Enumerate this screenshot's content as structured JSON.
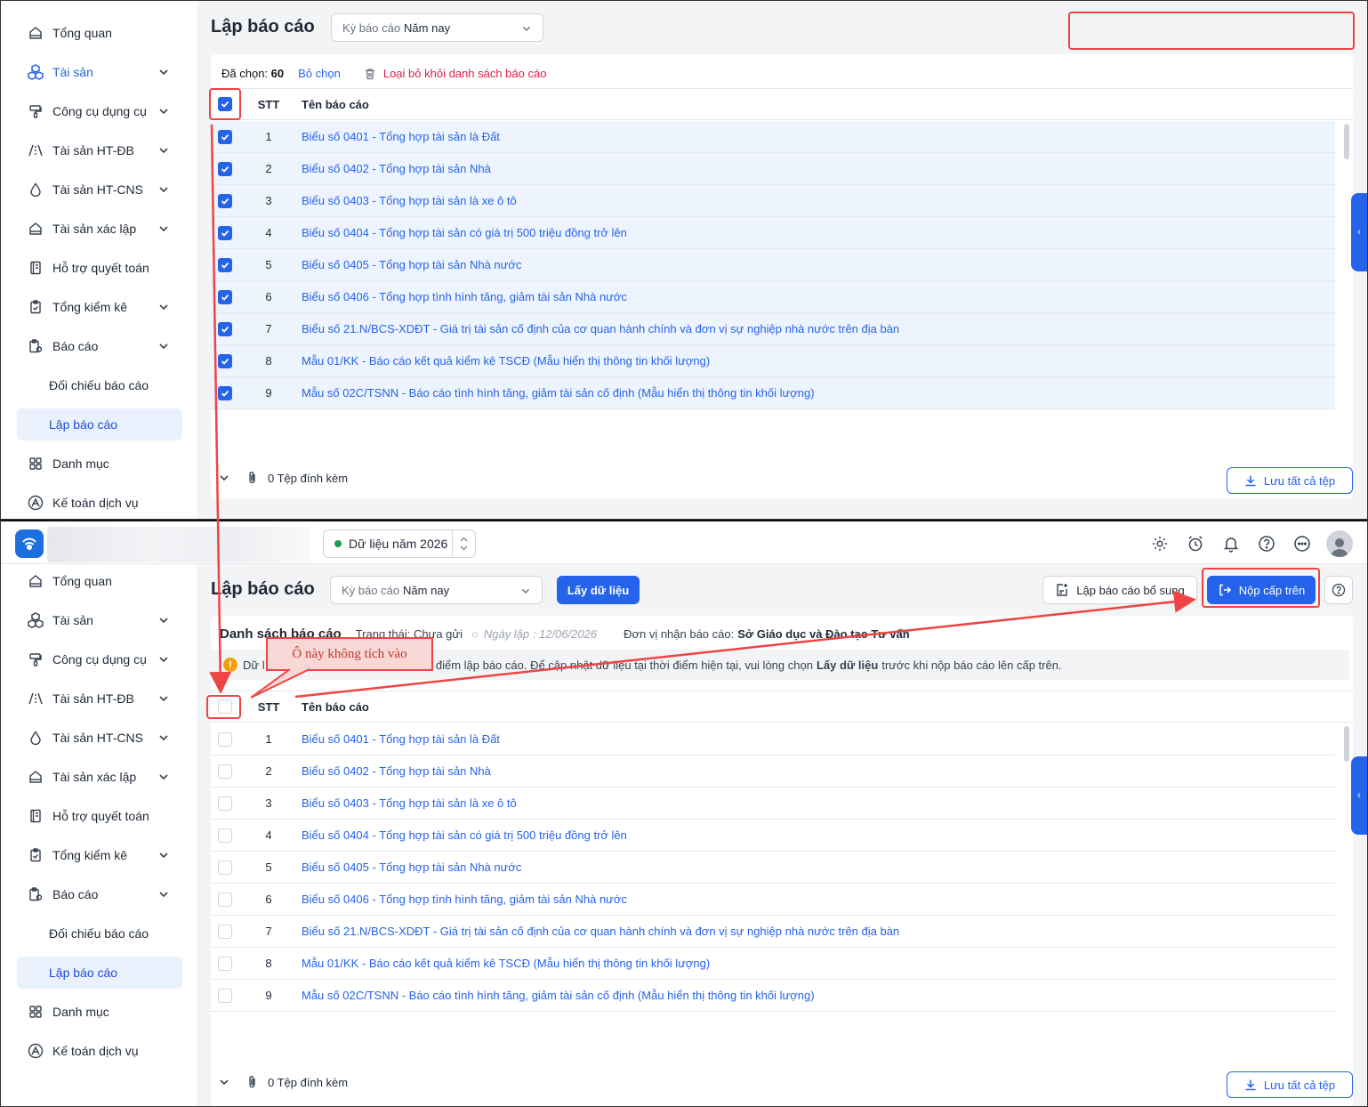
{
  "sidebar": {
    "items": [
      {
        "label": "Tổng quan",
        "icon": "home-icon",
        "chevron": false
      },
      {
        "label": "Tài sản",
        "icon": "assets-icon",
        "chevron": true
      },
      {
        "label": "Công cụ dụng cụ",
        "icon": "tools-icon",
        "chevron": true
      },
      {
        "label": "Tài sản HT-ĐB",
        "icon": "road-icon",
        "chevron": true
      },
      {
        "label": "Tài sản HT-CNS",
        "icon": "water-icon",
        "chevron": true
      },
      {
        "label": "Tài sản xác lập",
        "icon": "building-icon",
        "chevron": true
      },
      {
        "label": "Hỗ trợ quyết toán",
        "icon": "ledger-icon",
        "chevron": false
      },
      {
        "label": "Tổng kiểm kê",
        "icon": "clipboard-icon",
        "chevron": true
      },
      {
        "label": "Báo cáo",
        "icon": "report-icon",
        "chevron": true
      },
      {
        "label": "Đối chiếu báo cáo",
        "icon": "",
        "chevron": false
      },
      {
        "label": "Lập báo cáo",
        "icon": "",
        "chevron": false
      },
      {
        "label": "Danh mục",
        "icon": "grid-icon",
        "chevron": false
      },
      {
        "label": "Kế toán dịch vụ",
        "icon": "service-icon",
        "chevron": false
      }
    ]
  },
  "appbar": {
    "data_year": "Dữ liệu năm 2026"
  },
  "top": {
    "title": "Lập báo cáo",
    "period_label": "Kỳ báo cáo",
    "period_value": "Năm nay",
    "selected_prefix": "Đã chọn:",
    "selected_count": "60",
    "deselect": "Bỏ chọn",
    "remove": "Loại bỏ khỏi danh sách báo cáo",
    "attach": "0 Tệp đính kèm",
    "save_all": "Lưu tất cả tệp"
  },
  "bottom": {
    "title": "Lập báo cáo",
    "period_label": "Kỳ báo cáo",
    "period_value": "Năm nay",
    "fetch": "Lấy dữ liệu",
    "supplement": "Lập báo cáo bổ sung",
    "submit": "Nộp cấp trên",
    "list_title": "Danh sách báo cáo",
    "status": "Trạng thái: Chưa gửi",
    "date": "Ngày lập : 12/06/2026",
    "recipient_label": "Đơn vị nhận báo cáo:",
    "recipient": "Sở Giáo dục và Đào tạo Tư vấn",
    "warn_a": "Dữ l",
    "warn_b": "hời điểm lập báo cáo. Để cập nhật dữ liệu tại thời điểm hiện tại, vui lòng chọn",
    "warn_bold": "Lấy dữ liệu",
    "warn_c": "trước khi nộp báo cáo lên cấp trên.",
    "attach": "0 Tệp đính kèm",
    "save_all": "Lưu tất cả tệp"
  },
  "table": {
    "col_stt": "STT",
    "col_name": "Tên báo cáo",
    "rows": [
      {
        "stt": "1",
        "name": "Biểu số 0401 - Tổng hợp tài sản là Đất"
      },
      {
        "stt": "2",
        "name": "Biểu số 0402 - Tổng hợp tài sản Nhà"
      },
      {
        "stt": "3",
        "name": "Biểu số 0403 - Tổng hợp tài sản là xe ô tô"
      },
      {
        "stt": "4",
        "name": "Biểu số 0404 - Tổng hợp tài sản có giá trị 500 triệu đồng trở lên"
      },
      {
        "stt": "5",
        "name": "Biểu số 0405 - Tổng hợp tài sản Nhà nước"
      },
      {
        "stt": "6",
        "name": "Biểu số 0406 - Tổng hợp tình hình tăng, giảm tài sản Nhà nước"
      },
      {
        "stt": "7",
        "name": "Biểu số 21.N/BCS-XDĐT - Giá trị tài sản cố định của cơ quan hành chính và đơn vị sự nghiệp nhà nước trên địa bàn"
      },
      {
        "stt": "8",
        "name": "Mẫu 01/KK - Báo cáo kết quả kiểm kê TSCĐ (Mẫu hiển thị thông tin khối lượng)"
      },
      {
        "stt": "9",
        "name": "Mẫu số 02C/TSNN - Báo cáo tình hình tăng, giảm tài sản cố định (Mẫu hiển thị thông tin khối lượng)"
      }
    ]
  },
  "annotation": {
    "callout": "Ô này không tích vào"
  },
  "colors": {
    "accent": "#2563eb",
    "highlight": "#ef4444",
    "selected_row": "#eef4fd"
  }
}
